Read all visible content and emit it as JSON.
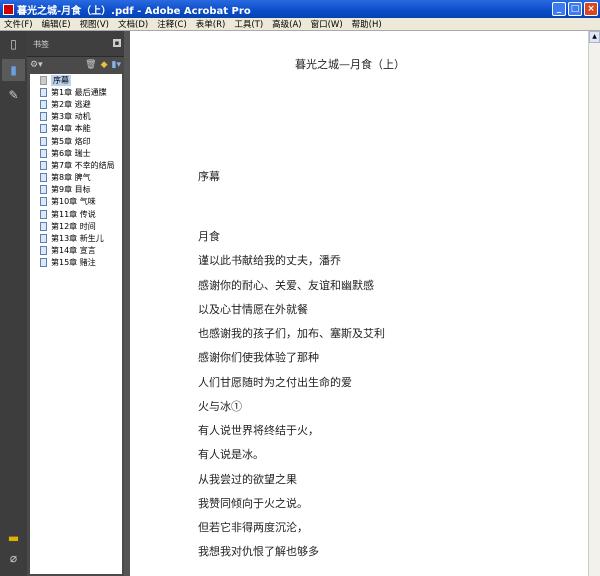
{
  "window": {
    "title": "暮光之城-月食（上）.pdf - Adobe Acrobat Pro"
  },
  "menu": [
    "文件(F)",
    "编辑(E)",
    "视图(V)",
    "文档(D)",
    "注释(C)",
    "表单(R)",
    "工具(T)",
    "高级(A)",
    "窗口(W)",
    "帮助(H)"
  ],
  "panel": {
    "title": "书签"
  },
  "bookmarks": [
    "序幕",
    "第1章 最后通牒",
    "第2章 逃避",
    "第3章 动机",
    "第4章 本能",
    "第5章 烙印",
    "第6章 瑞士",
    "第7章 不幸的结局",
    "第8章 脾气",
    "第9章 目标",
    "第10章 气味",
    "第11章 传说",
    "第12章 时间",
    "第13章 新生儿",
    "第14章 宣言",
    "第15章 赌注"
  ],
  "document": {
    "title": "暮光之城—月食（上）",
    "lines": [
      "序幕",
      "月食",
      "谨以此书献给我的丈夫，潘乔",
      "感谢你的耐心、关爱、友谊和幽默感",
      "以及心甘情愿在外就餐",
      "也感谢我的孩子们，加布、塞斯及艾利",
      "感谢你们使我体验了那种",
      "人们甘愿随时为之付出生命的爱",
      "火与冰①",
      "有人说世界将终结于火，",
      "有人说是冰。",
      "从我尝过的欲望之果",
      "我赞同倾向于火之说。",
      "但若它非得两度沉沦，",
      "我想我对仇恨了解也够多"
    ]
  }
}
